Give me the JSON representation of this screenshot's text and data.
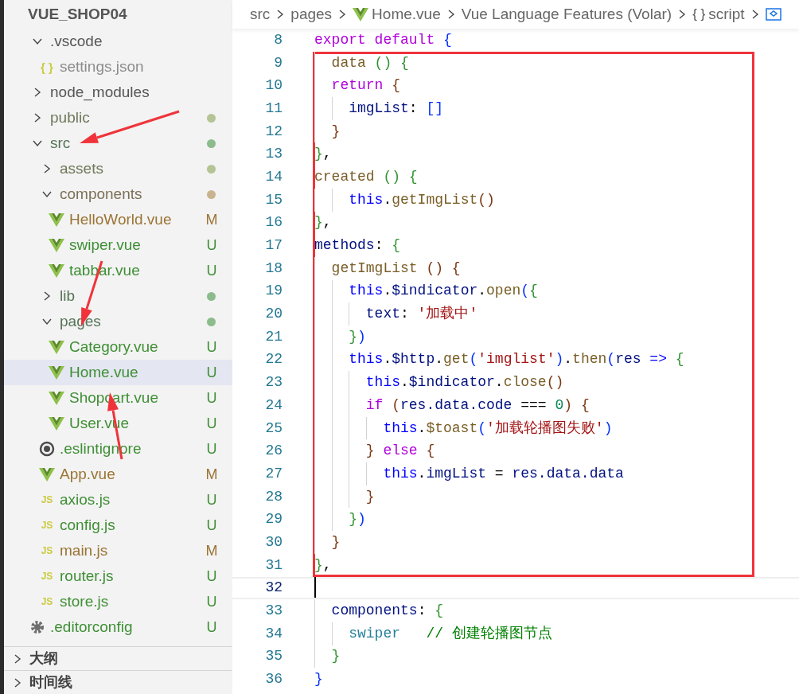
{
  "explorer": {
    "title": "VUE_SHOP04",
    "items": [
      {
        "label": ".vscode",
        "kind": "folder",
        "expanded": true,
        "ignored": true,
        "selected": false,
        "children": [
          {
            "label": "settings.json",
            "kind": "json",
            "icon_text": "{ }",
            "ignored": true,
            "selected": false
          }
        ]
      },
      {
        "label": "node_modules",
        "kind": "folder",
        "expanded": false,
        "ignored": true,
        "selected": false
      },
      {
        "label": "public",
        "kind": "folder",
        "expanded": false,
        "ignored": false,
        "selected": false,
        "color": "#b5c495"
      },
      {
        "label": "src",
        "kind": "folder",
        "expanded": true,
        "ignored": false,
        "selected": false,
        "color": "#8cbc8c",
        "children": [
          {
            "label": "assets",
            "kind": "folder",
            "expanded": false,
            "ignored": false,
            "selected": false,
            "color": "#b5c495"
          },
          {
            "label": "components",
            "kind": "folder",
            "expanded": true,
            "ignored": false,
            "selected": false,
            "color": "#c9b48f",
            "children": [
              {
                "label": "HelloWorld.vue",
                "kind": "vue",
                "ignored": false,
                "selected": false,
                "badge": "M",
                "color": "#9b7434"
              },
              {
                "label": "swiper.vue",
                "kind": "vue",
                "ignored": false,
                "selected": false,
                "badge": "U",
                "color": "#3f8f35"
              },
              {
                "label": "tabbar.vue",
                "kind": "vue",
                "ignored": false,
                "selected": false,
                "badge": "U",
                "color": "#3f8f35"
              }
            ]
          },
          {
            "label": "lib",
            "kind": "folder",
            "expanded": false,
            "ignored": false,
            "selected": false,
            "color": "#8cbc8c"
          },
          {
            "label": "pages",
            "kind": "folder",
            "expanded": true,
            "ignored": false,
            "selected": false,
            "color": "#8cbc8c",
            "children": [
              {
                "label": "Category.vue",
                "kind": "vue",
                "ignored": false,
                "selected": false,
                "badge": "U",
                "color": "#3f8f35"
              },
              {
                "label": "Home.vue",
                "kind": "vue",
                "ignored": false,
                "selected": true,
                "badge": "U",
                "color": "#3f8f35"
              },
              {
                "label": "Shopcart.vue",
                "kind": "vue",
                "ignored": false,
                "selected": false,
                "badge": "U",
                "color": "#3f8f35"
              },
              {
                "label": "User.vue",
                "kind": "vue",
                "ignored": false,
                "selected": false,
                "badge": "U",
                "color": "#3f8f35"
              }
            ]
          },
          {
            "label": ".eslintignore",
            "kind": "eslint",
            "ignored": false,
            "selected": false,
            "badge": "U",
            "color": "#3f8f35"
          },
          {
            "label": "App.vue",
            "kind": "vue",
            "ignored": false,
            "selected": false,
            "badge": "M",
            "color": "#9b7434"
          },
          {
            "label": "axios.js",
            "kind": "js",
            "icon_text": "JS",
            "ignored": false,
            "selected": false,
            "badge": "U",
            "color": "#3f8f35"
          },
          {
            "label": "config.js",
            "kind": "js",
            "icon_text": "JS",
            "ignored": false,
            "selected": false,
            "badge": "U",
            "color": "#3f8f35"
          },
          {
            "label": "main.js",
            "kind": "js",
            "icon_text": "JS",
            "ignored": false,
            "selected": false,
            "badge": "M",
            "color": "#9b7434"
          },
          {
            "label": "router.js",
            "kind": "js",
            "icon_text": "JS",
            "ignored": false,
            "selected": false,
            "badge": "U",
            "color": "#3f8f35"
          },
          {
            "label": "store.js",
            "kind": "js",
            "icon_text": "JS",
            "ignored": false,
            "selected": false,
            "badge": "U",
            "color": "#3f8f35"
          }
        ]
      },
      {
        "label": ".editorconfig",
        "kind": "config",
        "ignored": false,
        "selected": false,
        "badge": "U",
        "color": "#3f8f35"
      }
    ]
  },
  "panels": [
    {
      "label": "大纲",
      "expanded": false
    },
    {
      "label": "时间线",
      "expanded": false
    }
  ],
  "breadcrumb": [
    {
      "kind": "plain",
      "label": "src"
    },
    {
      "kind": "plain",
      "label": "pages"
    },
    {
      "kind": "vue",
      "label": "Home.vue"
    },
    {
      "kind": "plain",
      "label": "Vue Language Features (Volar)"
    },
    {
      "kind": "script",
      "icon_text": "{ }",
      "label": "script"
    },
    {
      "kind": "symbol"
    }
  ],
  "annotations": [
    {
      "kind": "arrow"
    },
    {
      "kind": "arrow"
    },
    {
      "kind": "arrow"
    }
  ],
  "lines": [
    {
      "number": "8",
      "boxed": false,
      "current": false,
      "tokens": [
        {
          "text": "export default",
          "kind": "kw"
        },
        {
          "text": " {",
          "kind": "b1"
        }
      ]
    },
    {
      "number": "9",
      "boxed": true,
      "current": false,
      "tokens": [
        {
          "text": "  data",
          "kind": "fn"
        },
        {
          "text": " ()",
          "kind": "b2"
        },
        {
          "text": " {",
          "kind": "b2"
        }
      ]
    },
    {
      "number": "10",
      "boxed": true,
      "current": false,
      "tokens": [
        {
          "text": "  return",
          "kind": "kw"
        },
        {
          "text": " {",
          "kind": "b3"
        }
      ]
    },
    {
      "number": "11",
      "boxed": true,
      "current": false,
      "tokens": [
        {
          "text": "    imgList",
          "kind": "var"
        },
        {
          "text": ": ",
          "kind": "p"
        },
        {
          "text": "[]",
          "kind": "b1"
        }
      ]
    },
    {
      "number": "12",
      "boxed": true,
      "current": false,
      "tokens": [
        {
          "text": "  }",
          "kind": "b3"
        }
      ]
    },
    {
      "number": "13",
      "boxed": true,
      "current": false,
      "tokens": [
        {
          "text": "}",
          "kind": "b2"
        },
        {
          "text": ",",
          "kind": "p"
        }
      ]
    },
    {
      "number": "14",
      "boxed": true,
      "current": false,
      "tokens": [
        {
          "text": "created",
          "kind": "fn"
        },
        {
          "text": " ()",
          "kind": "b2"
        },
        {
          "text": " {",
          "kind": "b2"
        }
      ]
    },
    {
      "number": "15",
      "boxed": true,
      "current": false,
      "tokens": [
        {
          "text": "    this",
          "kind": "this"
        },
        {
          "text": ".",
          "kind": "p"
        },
        {
          "text": "getImgList",
          "kind": "fn"
        },
        {
          "text": "()",
          "kind": "b3"
        }
      ]
    },
    {
      "number": "16",
      "boxed": true,
      "current": false,
      "tokens": [
        {
          "text": "}",
          "kind": "b2"
        },
        {
          "text": ",",
          "kind": "p"
        }
      ]
    },
    {
      "number": "17",
      "boxed": true,
      "current": false,
      "tokens": [
        {
          "text": "methods",
          "kind": "var"
        },
        {
          "text": ": ",
          "kind": "p"
        },
        {
          "text": "{",
          "kind": "b2"
        }
      ]
    },
    {
      "number": "18",
      "boxed": true,
      "current": false,
      "tokens": [
        {
          "text": "  getImgList",
          "kind": "fn"
        },
        {
          "text": " ()",
          "kind": "b3"
        },
        {
          "text": " {",
          "kind": "b3"
        }
      ]
    },
    {
      "number": "19",
      "boxed": true,
      "current": false,
      "tokens": [
        {
          "text": "    this",
          "kind": "this"
        },
        {
          "text": ".",
          "kind": "p"
        },
        {
          "text": "$indicator",
          "kind": "var"
        },
        {
          "text": ".",
          "kind": "p"
        },
        {
          "text": "open",
          "kind": "fn"
        },
        {
          "text": "(",
          "kind": "b1"
        },
        {
          "text": "{",
          "kind": "b2"
        }
      ]
    },
    {
      "number": "20",
      "boxed": true,
      "current": false,
      "tokens": [
        {
          "text": "      text",
          "kind": "var"
        },
        {
          "text": ": ",
          "kind": "p"
        },
        {
          "text": "'加载中'",
          "kind": "str"
        }
      ]
    },
    {
      "number": "21",
      "boxed": true,
      "current": false,
      "tokens": [
        {
          "text": "    }",
          "kind": "b2"
        },
        {
          "text": ")",
          "kind": "b1"
        }
      ]
    },
    {
      "number": "22",
      "boxed": true,
      "current": false,
      "tokens": [
        {
          "text": "    this",
          "kind": "this"
        },
        {
          "text": ".",
          "kind": "p"
        },
        {
          "text": "$http",
          "kind": "var"
        },
        {
          "text": ".",
          "kind": "p"
        },
        {
          "text": "get",
          "kind": "fn"
        },
        {
          "text": "(",
          "kind": "b1"
        },
        {
          "text": "'imglist'",
          "kind": "str"
        },
        {
          "text": ")",
          "kind": "b1"
        },
        {
          "text": ".",
          "kind": "p"
        },
        {
          "text": "then",
          "kind": "fn"
        },
        {
          "text": "(",
          "kind": "b1"
        },
        {
          "text": "res",
          "kind": "var"
        },
        {
          "text": " =>",
          "kind": "this"
        },
        {
          "text": " {",
          "kind": "b2"
        }
      ]
    },
    {
      "number": "23",
      "boxed": true,
      "current": false,
      "tokens": [
        {
          "text": "      this",
          "kind": "this"
        },
        {
          "text": ".",
          "kind": "p"
        },
        {
          "text": "$indicator",
          "kind": "var"
        },
        {
          "text": ".",
          "kind": "p"
        },
        {
          "text": "close",
          "kind": "fn"
        },
        {
          "text": "()",
          "kind": "b3"
        }
      ]
    },
    {
      "number": "24",
      "boxed": true,
      "current": false,
      "tokens": [
        {
          "text": "      if",
          "kind": "kw"
        },
        {
          "text": " (",
          "kind": "b3"
        },
        {
          "text": "res.data.code",
          "kind": "var"
        },
        {
          "text": " === ",
          "kind": "p"
        },
        {
          "text": "0",
          "kind": "num"
        },
        {
          "text": ")",
          "kind": "b3"
        },
        {
          "text": " {",
          "kind": "b3"
        }
      ]
    },
    {
      "number": "25",
      "boxed": true,
      "current": false,
      "tokens": [
        {
          "text": "        this",
          "kind": "this"
        },
        {
          "text": ".",
          "kind": "p"
        },
        {
          "text": "$toast",
          "kind": "fn"
        },
        {
          "text": "(",
          "kind": "b1"
        },
        {
          "text": "'加载轮播图失败'",
          "kind": "str"
        },
        {
          "text": ")",
          "kind": "b1"
        }
      ]
    },
    {
      "number": "26",
      "boxed": true,
      "current": false,
      "tokens": [
        {
          "text": "      }",
          "kind": "b3"
        },
        {
          "text": " else",
          "kind": "kw"
        },
        {
          "text": " {",
          "kind": "b3"
        }
      ]
    },
    {
      "number": "27",
      "boxed": true,
      "current": false,
      "tokens": [
        {
          "text": "        this",
          "kind": "this"
        },
        {
          "text": ".",
          "kind": "p"
        },
        {
          "text": "imgList",
          "kind": "var"
        },
        {
          "text": " = ",
          "kind": "p"
        },
        {
          "text": "res.data.data",
          "kind": "var"
        }
      ]
    },
    {
      "number": "28",
      "boxed": true,
      "current": false,
      "tokens": [
        {
          "text": "      }",
          "kind": "b3"
        }
      ]
    },
    {
      "number": "29",
      "boxed": true,
      "current": false,
      "tokens": [
        {
          "text": "    }",
          "kind": "b2"
        },
        {
          "text": ")",
          "kind": "b1"
        }
      ]
    },
    {
      "number": "30",
      "boxed": true,
      "current": false,
      "tokens": [
        {
          "text": "  }",
          "kind": "b3"
        }
      ]
    },
    {
      "number": "31",
      "boxed": true,
      "current": false,
      "tokens": [
        {
          "text": "}",
          "kind": "b2"
        },
        {
          "text": ",",
          "kind": "p"
        }
      ]
    },
    {
      "number": "32",
      "boxed": false,
      "current": true
    },
    {
      "number": "33",
      "boxed": false,
      "current": false,
      "tokens": [
        {
          "text": "  components",
          "kind": "var"
        },
        {
          "text": ": ",
          "kind": "p"
        },
        {
          "text": "{",
          "kind": "b2"
        }
      ]
    },
    {
      "number": "34",
      "boxed": false,
      "current": false,
      "tokens": [
        {
          "text": "    swiper",
          "kind": "type"
        },
        {
          "text": "   // 创建轮播图节点",
          "kind": "com"
        }
      ]
    },
    {
      "number": "35",
      "boxed": false,
      "current": false,
      "tokens": [
        {
          "text": "  }",
          "kind": "b2"
        }
      ]
    },
    {
      "number": "36",
      "boxed": false,
      "current": false,
      "tokens": [
        {
          "text": "}",
          "kind": "b1"
        }
      ]
    }
  ]
}
